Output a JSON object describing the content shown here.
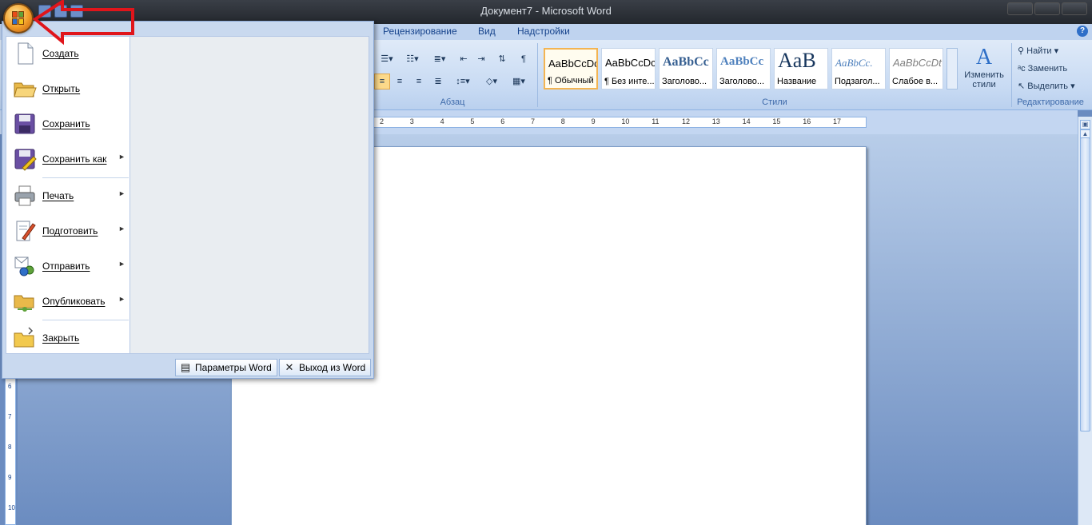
{
  "window": {
    "title": "Документ7 - Microsoft Word"
  },
  "ribbon": {
    "tabs": [
      "Рецензирование",
      "Вид",
      "Надстройки"
    ],
    "groups": {
      "paragraph": "Абзац",
      "styles": "Стили",
      "editing": "Редактирование"
    },
    "styles": [
      {
        "sample": "AaBbCcDc",
        "name": "¶ Обычный",
        "active": true
      },
      {
        "sample": "AaBbCcDc",
        "name": "¶ Без инте..."
      },
      {
        "sample": "AaBbCc",
        "name": "Заголово..."
      },
      {
        "sample": "AaBbCc",
        "name": "Заголово..."
      },
      {
        "sample": "AaB",
        "name": "Название"
      },
      {
        "sample": "AaBbCc.",
        "name": "Подзагол..."
      },
      {
        "sample": "AaBbCcDt",
        "name": "Слабое в..."
      }
    ],
    "change_styles": "Изменить стили",
    "editing": {
      "find": "Найти",
      "replace": "Заменить",
      "select": "Выделить"
    }
  },
  "ruler": {
    "marks": [
      "2",
      "3",
      "4",
      "5",
      "6",
      "7",
      "8",
      "9",
      "10",
      "11",
      "12",
      "13",
      "14",
      "15",
      "16",
      "17"
    ],
    "left_marks": [
      "6",
      "7",
      "8",
      "9",
      "10"
    ]
  },
  "office_menu": {
    "items": [
      {
        "label": "Создать",
        "icon": "new-document-icon",
        "submenu": false
      },
      {
        "label": "Открыть",
        "icon": "open-folder-icon",
        "submenu": false
      },
      {
        "label": "Сохранить",
        "icon": "save-floppy-icon",
        "submenu": false
      },
      {
        "label": "Сохранить как",
        "icon": "save-as-icon",
        "submenu": true
      },
      {
        "label": "Печать",
        "icon": "printer-icon",
        "submenu": true
      },
      {
        "label": "Подготовить",
        "icon": "prepare-document-icon",
        "submenu": true
      },
      {
        "label": "Отправить",
        "icon": "send-icon",
        "submenu": true
      },
      {
        "label": "Опубликовать",
        "icon": "publish-icon",
        "submenu": true
      },
      {
        "label": "Закрыть",
        "icon": "close-folder-icon",
        "submenu": false
      }
    ],
    "footer": {
      "options": "Параметры Word",
      "exit": "Выход из Word"
    }
  },
  "colors": {
    "accent": "#15428b",
    "annotation": "#e0151b",
    "office_button": "#f19c28"
  }
}
